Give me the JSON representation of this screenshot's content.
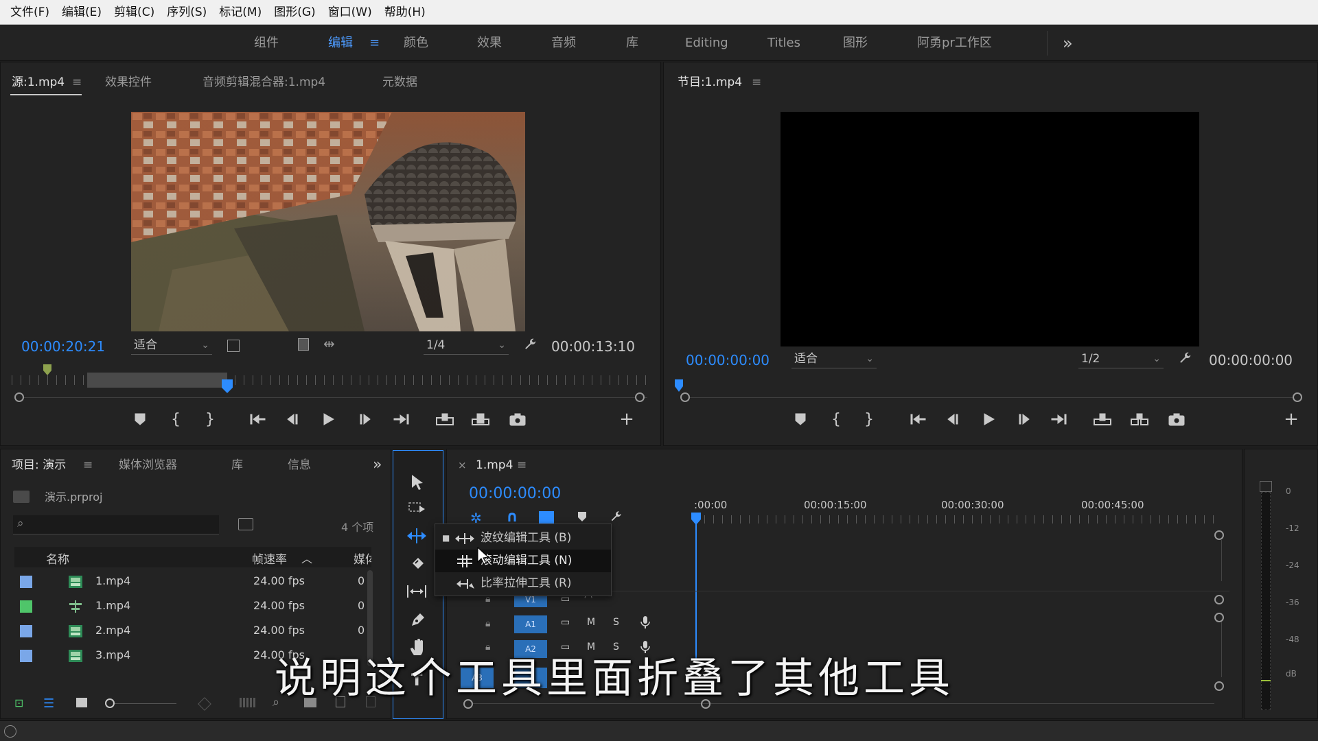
{
  "menu": [
    "文件(F)",
    "编辑(E)",
    "剪辑(C)",
    "序列(S)",
    "标记(M)",
    "图形(G)",
    "窗口(W)",
    "帮助(H)"
  ],
  "workspaces": [
    "组件",
    "编辑",
    "颜色",
    "效果",
    "音频",
    "库",
    "Editing",
    "Titles",
    "图形",
    "阿勇pr工作区"
  ],
  "active_workspace": "编辑",
  "workspace_more": "»",
  "menu_glyph": "≡",
  "source": {
    "tabs": [
      "源:1.mp4",
      "效果控件",
      "音频剪辑混合器:1.mp4",
      "元数据"
    ],
    "timecode": "00:00:20:21",
    "fit": "适合",
    "resolution": "1/4",
    "duration": "00:00:13:10",
    "playhead_position": 0.34
  },
  "program": {
    "tab": "节目:1.mp4",
    "timecode": "00:00:00:00",
    "fit": "适合",
    "resolution": "1/2",
    "duration": "00:00:00:00"
  },
  "project": {
    "tabs": [
      "项目: 演示",
      "媒体浏览器",
      "库",
      "信息"
    ],
    "file": "演示.prproj",
    "search_placeholder": "",
    "count": "4 个项",
    "columns": {
      "name": "名称",
      "fps": "帧速率",
      "media": "媒体"
    },
    "items": [
      {
        "color": "#7aa7e8",
        "icon": "clip-icon",
        "name": "1.mp4",
        "fps": "24.00 fps",
        "media": "0"
      },
      {
        "color": "#4fc56a",
        "icon": "sequence-icon",
        "name": "1.mp4",
        "fps": "24.00 fps",
        "media": "0"
      },
      {
        "color": "#7aa7e8",
        "icon": "clip-icon",
        "name": "2.mp4",
        "fps": "24.00 fps",
        "media": "0"
      },
      {
        "color": "#7aa7e8",
        "icon": "clip-icon",
        "name": "3.mp4",
        "fps": "24.00 fps",
        "media": ""
      }
    ]
  },
  "tool_menu": {
    "items": [
      {
        "label": "波纹编辑工具 (B)",
        "icon": "ripple-edit-icon",
        "checked": true
      },
      {
        "label": "滚动编辑工具 (N)",
        "icon": "rolling-edit-icon",
        "checked": false
      },
      {
        "label": "比率拉伸工具 (R)",
        "icon": "rate-stretch-icon",
        "checked": false
      }
    ]
  },
  "timeline": {
    "tab": "1.mp4",
    "timecode": "00:00:00:00",
    "ruler": [
      ":00:00",
      "00:00:15:00",
      "00:00:30:00",
      "00:00:45:00"
    ],
    "tracks": [
      {
        "name": "V1",
        "m": "",
        "s": ""
      },
      {
        "name": "A1",
        "m": "M",
        "s": "S"
      },
      {
        "name": "A2",
        "m": "M",
        "s": "S"
      },
      {
        "name": "A3",
        "m": "",
        "s": ""
      }
    ]
  },
  "meter": {
    "labels": [
      "0",
      "-12",
      "-24",
      "-36",
      "-48",
      "dB"
    ]
  },
  "subtitle": "说明这个工具里面折叠了其他工具",
  "colors": {
    "accent": "#2d8cff",
    "panel": "#232323",
    "border": "#141414"
  }
}
